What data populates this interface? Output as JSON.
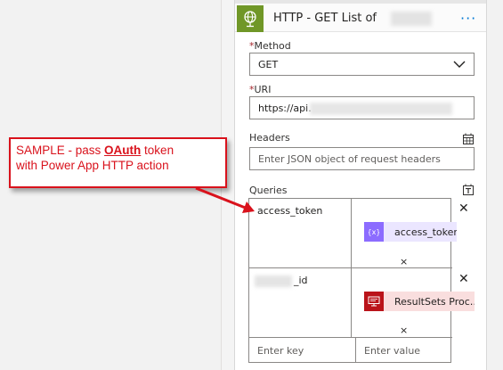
{
  "card": {
    "title": "HTTP - GET List of",
    "more_label": "···"
  },
  "method": {
    "required_mark": "*",
    "label": "Method",
    "value": "GET"
  },
  "uri": {
    "required_mark": "*",
    "label": "URI",
    "value_prefix": "https://api."
  },
  "headers": {
    "label": "Headers",
    "placeholder": "Enter JSON object of request headers"
  },
  "queries": {
    "label": "Queries",
    "rows": [
      {
        "key": "access_token",
        "token_label": "access_token",
        "token_kind": "expression",
        "token_icon": "variable-icon",
        "clear": "×",
        "delete": "✕"
      },
      {
        "key_suffix": "_id",
        "token_label": "ResultSets Proc…",
        "token_kind": "sql",
        "token_icon": "sql-server-icon",
        "clear": "×",
        "delete": "✕"
      }
    ],
    "new_key_placeholder": "Enter key",
    "new_value_placeholder": "Enter value"
  },
  "annotation": {
    "line1_before": "SAMPLE - pass ",
    "line1_bold": "OAuth",
    "line1_after": " token",
    "line2": "with Power App HTTP action"
  },
  "colors": {
    "http_icon_bg": "#709727",
    "expression_token_bg": "#8c6cff",
    "sql_token_bg": "#ba141a",
    "annotation_red": "#d9121c",
    "link_blue": "#0078d4"
  }
}
